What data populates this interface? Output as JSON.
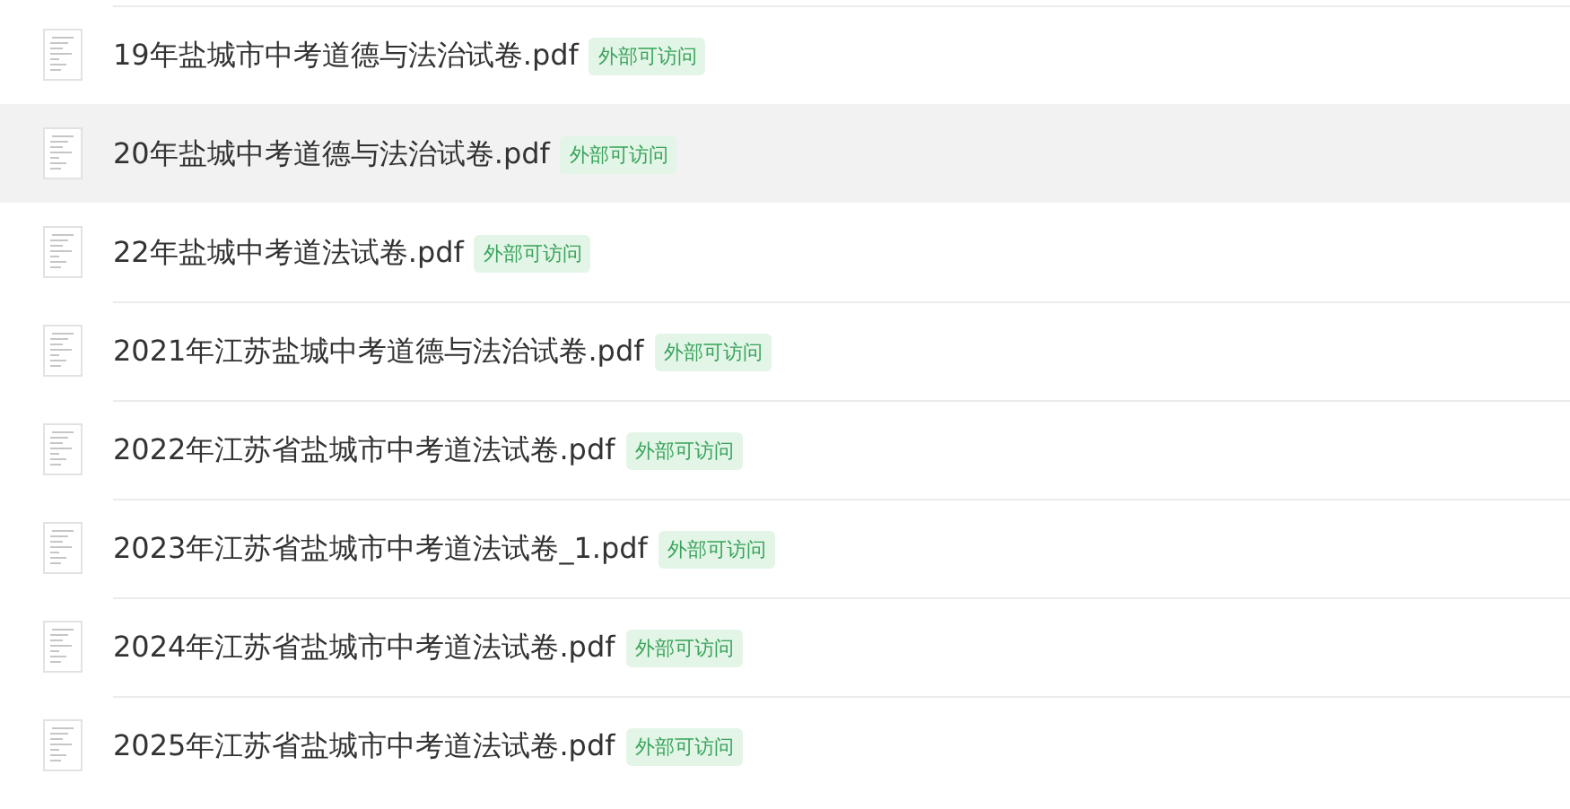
{
  "files": [
    {
      "name": "19年盐城市中考道德与法治试卷.pdf",
      "badge": "外部可访问",
      "selected": false
    },
    {
      "name": "20年盐城中考道德与法治试卷.pdf",
      "badge": "外部可访问",
      "selected": true
    },
    {
      "name": "22年盐城中考道法试卷.pdf",
      "badge": "外部可访问",
      "selected": false
    },
    {
      "name": "2021年江苏盐城中考道德与法治试卷.pdf",
      "badge": "外部可访问",
      "selected": false
    },
    {
      "name": "2022年江苏省盐城市中考道法试卷.pdf",
      "badge": "外部可访问",
      "selected": false
    },
    {
      "name": "2023年江苏省盐城市中考道法试卷_1.pdf",
      "badge": "外部可访问",
      "selected": false
    },
    {
      "name": "2024年江苏省盐城市中考道法试卷.pdf",
      "badge": "外部可访问",
      "selected": false
    },
    {
      "name": "2025年江苏省盐城市中考道法试卷.pdf",
      "badge": "外部可访问",
      "selected": false
    }
  ]
}
